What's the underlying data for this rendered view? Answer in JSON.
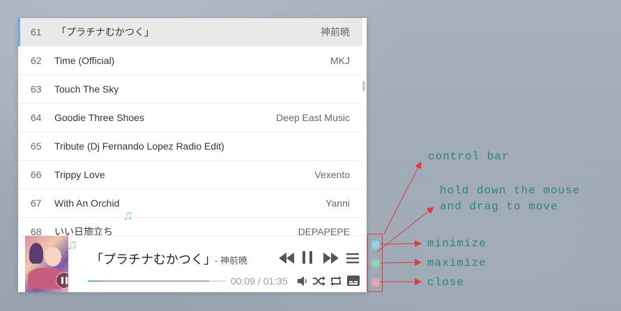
{
  "playlist": [
    {
      "num": "61",
      "title": "「プラチナむかつく」",
      "artist": "神前暁",
      "active": true
    },
    {
      "num": "62",
      "title": "Time (Official)",
      "artist": "MKJ",
      "active": false
    },
    {
      "num": "63",
      "title": "Touch The Sky",
      "artist": "",
      "active": false
    },
    {
      "num": "64",
      "title": "Goodie Three Shoes",
      "artist": "Deep East Music",
      "active": false
    },
    {
      "num": "65",
      "title": "Tribute (Dj Fernando Lopez Radio Edit)",
      "artist": "",
      "active": false
    },
    {
      "num": "66",
      "title": "Trippy Love",
      "artist": "Vexento",
      "active": false
    },
    {
      "num": "67",
      "title": "With An Orchid",
      "artist": "Yanni",
      "active": false
    },
    {
      "num": "68",
      "title": "いい日旅立ち",
      "artist": "DEPAPEPE",
      "active": false
    }
  ],
  "now_playing": {
    "title": "「プラチナむかつく」",
    "artist": "- 神前暁",
    "time": "00:09 / 01:35",
    "played_fraction": 0.1,
    "loaded_fraction": 0.88
  },
  "annotations": {
    "control_bar": "control bar",
    "drag_line1": "hold down the mouse",
    "drag_line2": "and drag to move",
    "minimize": "minimize",
    "maximize": "maximize",
    "close": "close"
  },
  "colors": {
    "accent": "#66afe9",
    "minimize": "#8fd3e6",
    "maximize": "#8fd6b2",
    "close": "#eda3b2",
    "annotation_text": "#2e8572",
    "annotation_line": "#e23a3a"
  },
  "icons": {
    "prev": "skip-back-icon",
    "pause": "pause-icon",
    "next": "skip-forward-icon",
    "menu": "menu-icon",
    "volume": "volume-icon",
    "shuffle": "shuffle-icon",
    "repeat": "repeat-icon",
    "lyrics": "lyrics-icon"
  }
}
